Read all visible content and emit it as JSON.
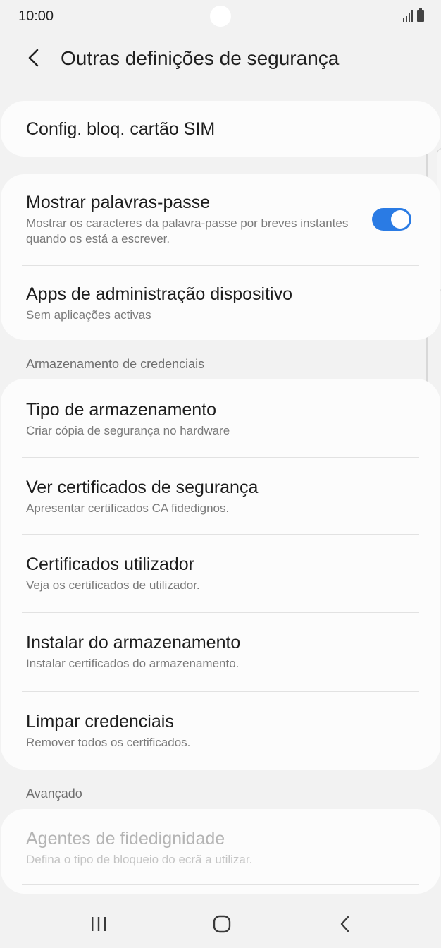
{
  "status_bar": {
    "time": "10:00"
  },
  "header": {
    "title": "Outras definições de segurança"
  },
  "sim_card_lock": {
    "title": "Config. bloq. cartão SIM"
  },
  "show_passwords": {
    "title": "Mostrar palavras-passe",
    "subtitle": "Mostrar os caracteres da palavra-passe por breves instantes quando os está a escrever.",
    "enabled": true
  },
  "device_admin_apps": {
    "title": "Apps de administração dispositivo",
    "subtitle": "Sem aplicações activas"
  },
  "credential_storage": {
    "section_title": "Armazenamento de credenciais",
    "items": [
      {
        "title": "Tipo de armazenamento",
        "subtitle": "Criar cópia de segurança no hardware"
      },
      {
        "title": "Ver certificados de segurança",
        "subtitle": "Apresentar certificados CA fidedignos."
      },
      {
        "title": "Certificados utilizador",
        "subtitle": "Veja os certificados de utilizador."
      },
      {
        "title": "Instalar do armazenamento",
        "subtitle": "Instalar certificados do armazenamento."
      },
      {
        "title": "Limpar credenciais",
        "subtitle": "Remover todos os certificados."
      }
    ]
  },
  "advanced": {
    "section_title": "Avançado",
    "items": [
      {
        "title": "Agentes de fidedignidade",
        "subtitle": "Defina o tipo de bloqueio do ecrã a utilizar.",
        "enabled": false
      }
    ]
  },
  "colors": {
    "background": "#f2f2f2",
    "card": "#fcfcfc",
    "toggle_on": "#2a7be4",
    "secondary_text": "#7a7a7a",
    "disabled_text": "#b4b4b4"
  },
  "icons": {
    "back": "chevron-left-icon",
    "nav_recents": "recent-apps-icon",
    "nav_home": "home-icon",
    "nav_back": "back-arrow-icon"
  }
}
